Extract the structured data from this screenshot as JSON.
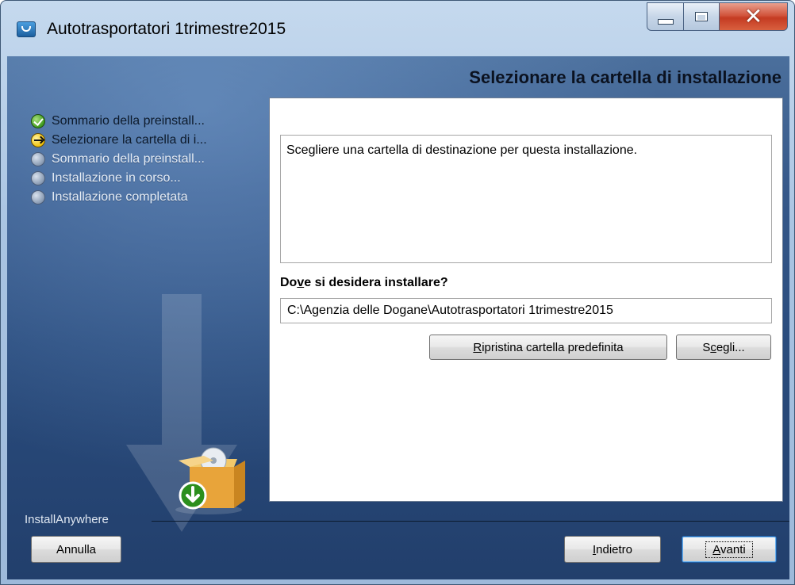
{
  "window": {
    "title": "Autotrasportatori 1trimestre2015",
    "icon": "installer-app-icon",
    "controls": {
      "minimize": "minimize-icon",
      "maximize": "maximize-icon",
      "close": "close-icon"
    }
  },
  "header": {
    "title": "Selezionare la cartella di installazione"
  },
  "steps": [
    {
      "label": "Sommario della preinstall...",
      "state": "done",
      "icon": "check-icon"
    },
    {
      "label": "Selezionare la cartella di i...",
      "state": "current",
      "icon": "arrow-right-icon"
    },
    {
      "label": "Sommario della preinstall...",
      "state": "pending",
      "icon": "circle-icon"
    },
    {
      "label": "Installazione in corso...",
      "state": "pending",
      "icon": "circle-icon"
    },
    {
      "label": "Installazione completata",
      "state": "pending",
      "icon": "circle-icon"
    }
  ],
  "main": {
    "description": "Scegliere una cartella di destinazione per questa installazione.",
    "question_pre": "Do",
    "question_mn": "v",
    "question_post": "e si desidera installare?",
    "install_path": "C:\\Agenzia delle Dogane\\Autotrasportatori 1trimestre2015",
    "reset_button": {
      "mn": "R",
      "rest": "ipristina cartella predefinita"
    },
    "choose_button": {
      "pre": "S",
      "mn": "c",
      "rest": "egli..."
    }
  },
  "footer": {
    "brand": "InstallAnywhere",
    "cancel": "Annulla",
    "back": {
      "mn": "I",
      "rest": "ndietro"
    },
    "next": {
      "mn": "A",
      "rest": "vanti"
    }
  },
  "colors": {
    "accent": "#1e5fa8",
    "panel_bg": "#2a4c7d",
    "header_text": "#0b1220"
  }
}
